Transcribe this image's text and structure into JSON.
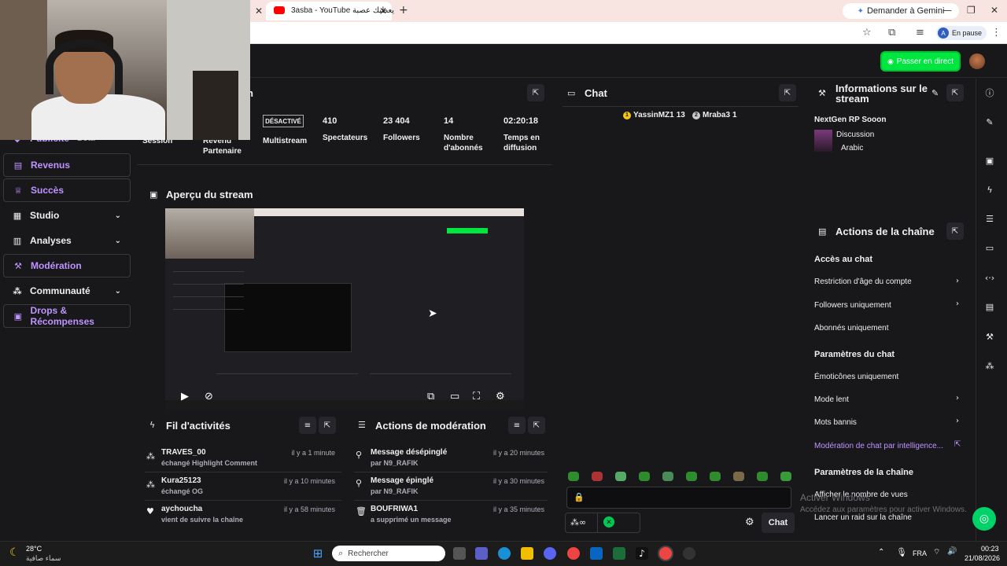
{
  "browser": {
    "tab_title": "3asba - YouTube يعطيك عصبة",
    "gemini_label": "Demander à Gemini",
    "profile_status": "En pause",
    "profile_initial": "A"
  },
  "topbar": {
    "go_live_label": "Passer en direct"
  },
  "nav": {
    "items": [
      {
        "label": "Publicité",
        "extra": "Bêta"
      },
      {
        "label": "Revenus"
      },
      {
        "label": "Succès"
      },
      {
        "label": "Studio"
      },
      {
        "label": "Analyses"
      },
      {
        "label": "Modération"
      },
      {
        "label": "Communauté"
      },
      {
        "label": "Drops & Récompenses"
      }
    ]
  },
  "session": {
    "title_partial": "n",
    "session_label": "Session",
    "revenue_label": "Revenu Partenaire",
    "multistream_badge": "DÉSACTIVÉ",
    "multistream_label": "Multistream",
    "viewers_value": "410",
    "viewers_label": "Spectateurs",
    "followers_value": "23 404",
    "followers_label": "Followers",
    "subs_value": "14",
    "subs_label": "Nombre d'abonnés",
    "time_value": "02:20:18",
    "time_label": "Temps en diffusion"
  },
  "preview": {
    "title": "Aperçu du stream"
  },
  "activity": {
    "title": "Fil d'activités",
    "items": [
      {
        "name": "TRAVES_00",
        "sub": "échangé Highlight Comment",
        "time": "il y a 1 minute"
      },
      {
        "name": "Kura25123",
        "sub": "échangé OG",
        "time": "il y a 10 minutes"
      },
      {
        "name": "aychoucha",
        "sub": "vient de suivre la chaîne",
        "time": "il y a 58 minutes"
      }
    ]
  },
  "moderation": {
    "title": "Actions de modération",
    "items": [
      {
        "name": "Message désépinglé",
        "sub": "par N9_RAFIK",
        "time": "il y a 20 minutes"
      },
      {
        "name": "Message épinglé",
        "sub": "par N9_RAFIK",
        "time": "il y a 30 minutes"
      },
      {
        "name": "BOUFRIWA1",
        "sub": "a supprimé un message",
        "time": "il y a 35 minutes"
      }
    ]
  },
  "chat": {
    "title": "Chat",
    "leaders": [
      {
        "rank": "1",
        "name": "YassinMZ1",
        "count": "13"
      },
      {
        "rank": "2",
        "name": "Mraba3",
        "count": "1"
      }
    ],
    "send_label": "Chat"
  },
  "stream_info": {
    "title": "Informations sur le stream",
    "stream_title": "NextGen RP Sooon",
    "category": "Discussion",
    "language": "Arabic"
  },
  "channel_actions": {
    "title": "Actions de la chaîne",
    "chat_access_title": "Accès au chat",
    "chat_access": [
      "Restriction d'âge du compte",
      "Followers uniquement",
      "Abonnés uniquement"
    ],
    "chat_params_title": "Paramètres du chat",
    "chat_params": [
      "Émoticônes uniquement",
      "Mode lent",
      "Mots bannis"
    ],
    "ai_moderation": "Modération de chat par intelligence...",
    "channel_params_title": "Paramètres de la chaîne",
    "channel_params": [
      "Afficher le nombre de vues",
      "Lancer un raid sur la chaîne"
    ]
  },
  "watermark": {
    "line1": "Activer Windows",
    "line2": "Accédez aux paramètres pour activer Windows."
  },
  "taskbar": {
    "weather_temp": "28°C",
    "weather_desc": "سماء صافية",
    "search_placeholder": "Rechercher",
    "lang": "FRA",
    "time": "00:23",
    "date": "21/08/2026"
  },
  "colors": {
    "accent": "#bf94ff",
    "go_live": "#00e640",
    "background": "#18181b"
  }
}
